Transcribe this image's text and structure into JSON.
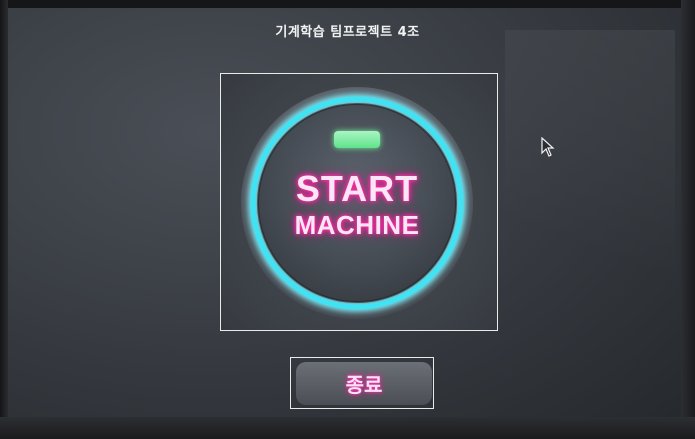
{
  "app": {
    "title": "기계학습 팀프로젝트 4조"
  },
  "start_button": {
    "line1": "START",
    "line2": "MACHINE",
    "ring_color": "#3fe3f3",
    "text_glow": "#ff2ea8",
    "status_led_color": "#6ff09a"
  },
  "end_button": {
    "label": "종료"
  },
  "icons": {
    "pointer": "mouse-pointer-icon",
    "led": "status-led-icon"
  }
}
